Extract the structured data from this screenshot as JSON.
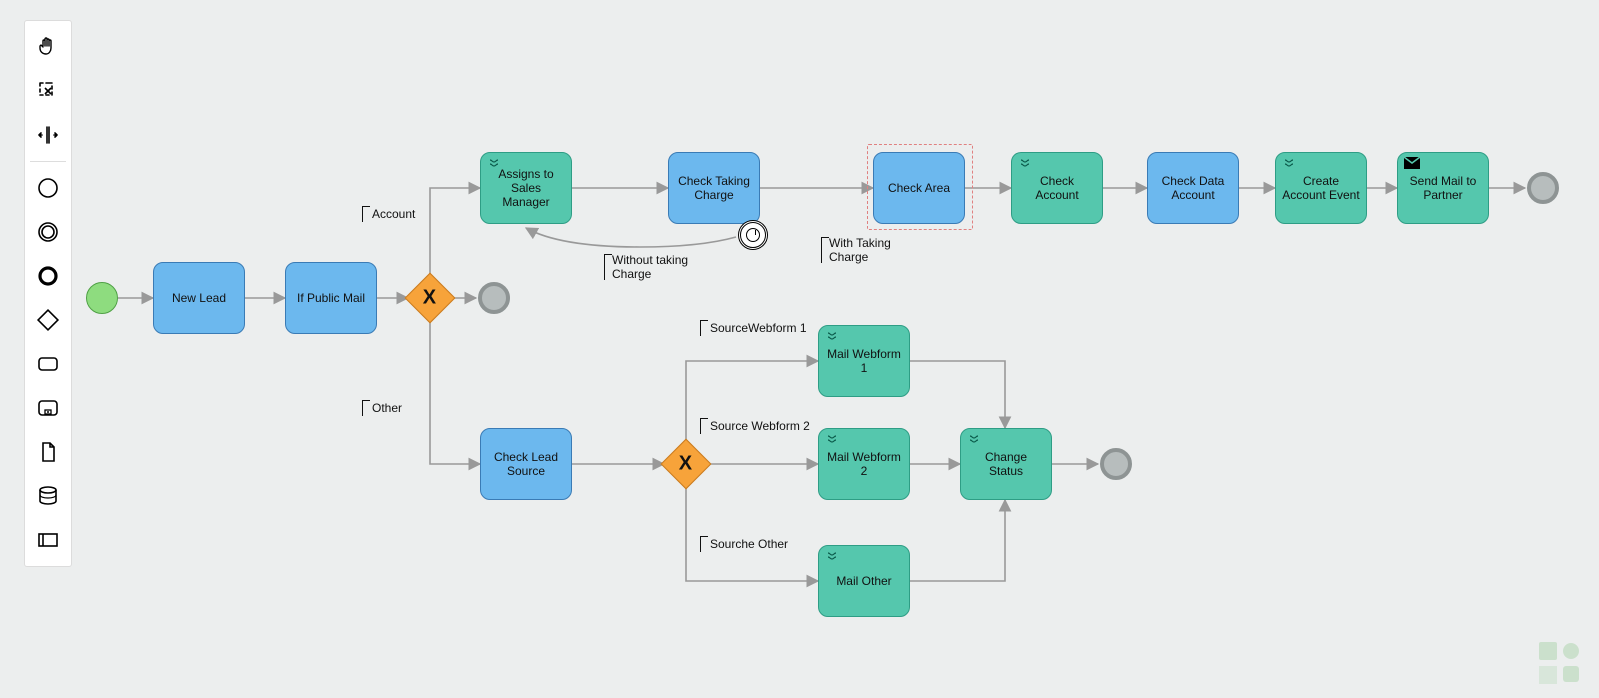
{
  "palette": {
    "hand": "hand-tool",
    "lasso": "lasso-tool",
    "space": "space-tool",
    "start_event": "start-event",
    "intermediate_event": "intermediate-event",
    "end_event": "end-event",
    "gateway": "gateway",
    "task": "task",
    "subprocess": "subprocess",
    "data_object": "data-object",
    "data_store": "data-store",
    "participant": "participant"
  },
  "nodes": {
    "start": "",
    "new_lead": "New Lead",
    "if_public_mail": "If Public Mail",
    "gateway1": "X",
    "end_top": "",
    "assigns_sales_mgr": "Assigns to Sales Manager",
    "check_taking_charge": "Check Taking Charge",
    "check_area": "Check Area",
    "check_account": "Check Account",
    "check_data_account": "Check Data Account",
    "create_account_event": "Create Account Event",
    "send_mail_partner": "Send Mail to Partner",
    "end_right": "",
    "check_lead_source": "Check Lead Source",
    "gateway2": "X",
    "mail_webform_1": "Mail Webform 1",
    "mail_webform_2": "Mail Webform 2",
    "mail_other": "Mail Other",
    "change_status": "Change Status",
    "end_bottom": ""
  },
  "edge_labels": {
    "account": "Account",
    "other": "Other",
    "without_taking_charge": "Without taking Charge",
    "with_taking_charge": "With Taking Charge",
    "source_webform_1": "SourceWebform 1",
    "source_webform_2": "Source Webform 2",
    "source_other": "Sourche Other"
  },
  "colors": {
    "task_blue_fill": "#6cb8ee",
    "task_teal_fill": "#55c7ad",
    "gateway_fill": "#f7a33a",
    "start_fill": "#8edc7f",
    "end_fill": "#b7bdbd",
    "edge": "#999"
  }
}
